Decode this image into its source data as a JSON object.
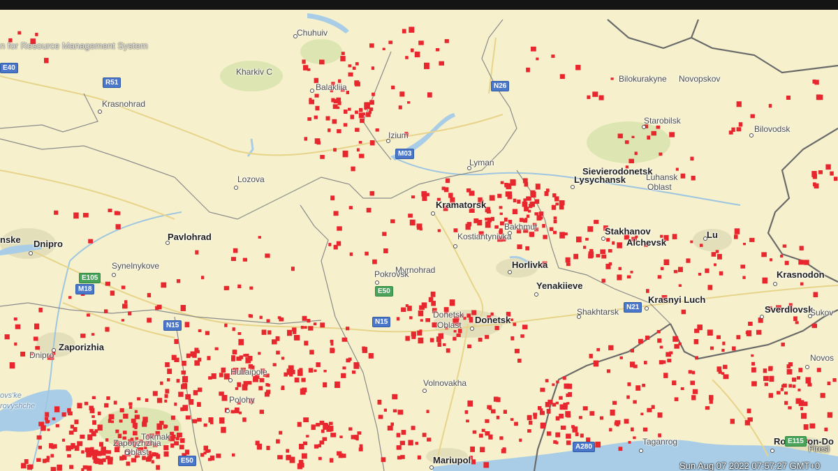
{
  "map": {
    "attribution": "n for Resource Management System",
    "timestamp": "Sun Aug 07 2022 07:57:27 GMT+0",
    "firms_tag": "Firesl",
    "colors": {
      "background": "#f6f1cc",
      "fire": "#e8262d",
      "water": "#a9cde6",
      "border": "#808080",
      "urban": "#e4dfbb",
      "vegetation": "#dde6b2"
    },
    "cities": [
      {
        "name": "Chuhuiv",
        "major": false
      },
      {
        "name": "Kharkiv C",
        "major": false
      },
      {
        "name": "Balakliia",
        "major": false
      },
      {
        "name": "Krasnohrad",
        "major": false
      },
      {
        "name": "Izium",
        "major": false
      },
      {
        "name": "Bilokurakyne",
        "major": false
      },
      {
        "name": "Novopskov",
        "major": false
      },
      {
        "name": "Starobilsk",
        "major": false
      },
      {
        "name": "Bilovodsk",
        "major": false
      },
      {
        "name": "Lozova",
        "major": false
      },
      {
        "name": "Lyman",
        "major": false
      },
      {
        "name": "Sievierodonetsk",
        "major": true
      },
      {
        "name": "Lysychansk",
        "major": true
      },
      {
        "name": "Luhansk",
        "major": false
      },
      {
        "name": "Oblast",
        "major": false
      },
      {
        "name": "Kramatorsk",
        "major": true
      },
      {
        "name": "nske",
        "major": true
      },
      {
        "name": "Dnipro",
        "major": true
      },
      {
        "name": "Pavlohrad",
        "major": true
      },
      {
        "name": "Kostiantynivka",
        "major": false
      },
      {
        "name": "Bakhmut",
        "major": false
      },
      {
        "name": "Stakhanov",
        "major": true
      },
      {
        "name": "Alchevsk",
        "major": true
      },
      {
        "name": "Lu",
        "major": true
      },
      {
        "name": "Synelnykove",
        "major": false
      },
      {
        "name": "Myrnohrad",
        "major": false
      },
      {
        "name": "Pokrovsk",
        "major": false
      },
      {
        "name": "Horlivka",
        "major": true
      },
      {
        "name": "Yenakiieve",
        "major": true
      },
      {
        "name": "Krasnodon",
        "major": true
      },
      {
        "name": "Krasnyi Luch",
        "major": true
      },
      {
        "name": "Shakhtarsk",
        "major": false
      },
      {
        "name": "Sverdlovsk",
        "major": true
      },
      {
        "name": "Sukov",
        "major": false
      },
      {
        "name": "Donetsk",
        "major": false
      },
      {
        "name": "Oblast",
        "major": false
      },
      {
        "name": "Donetsk",
        "major": true
      },
      {
        "name": "Zaporizhia",
        "major": true
      },
      {
        "name": "Dnipro",
        "major": false
      },
      {
        "name": "Huliaipole",
        "major": false
      },
      {
        "name": "Novos",
        "major": false
      },
      {
        "name": "Volnovakha",
        "major": false
      },
      {
        "name": "Polohy",
        "major": false
      },
      {
        "name": "Tokmak",
        "major": false
      },
      {
        "name": "Zaporizhzhia",
        "major": false
      },
      {
        "name": "Oblast",
        "major": false
      },
      {
        "name": "Taganrog",
        "major": false
      },
      {
        "name": "Mariupol",
        "major": true
      },
      {
        "name": "Rostov-on-Do",
        "major": true
      }
    ],
    "water_labels": [
      "ovs'ke",
      "rovyshche"
    ],
    "roads": [
      "E40",
      "R51",
      "N26",
      "M03",
      "E50",
      "E105",
      "M18",
      "N15",
      "N15",
      "N21",
      "A280",
      "E115",
      "E50"
    ]
  }
}
